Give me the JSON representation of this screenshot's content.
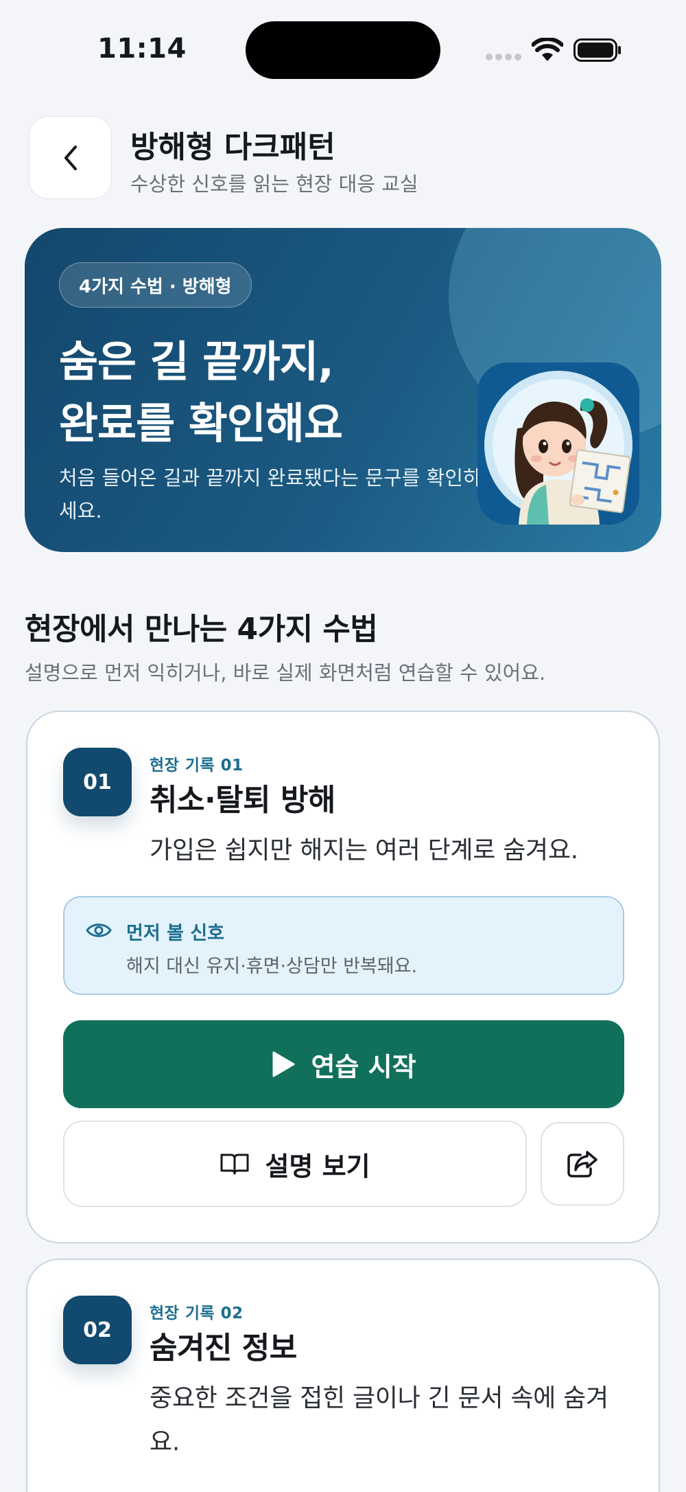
{
  "status_bar": {
    "time": "11:14"
  },
  "header": {
    "title": "방해형 다크패턴",
    "subtitle": "수상한 신호를 읽는 현장 대응 교실"
  },
  "hero": {
    "badge": "4가지 수법 · 방해형",
    "title_line1": "숨은 길 끝까지,",
    "title_line2": "완료를 확인해요",
    "description": "처음 들어온 길과 끝까지 완료됐다는 문구를 확인하세요."
  },
  "section": {
    "title": "현장에서 만나는 4가지 수법",
    "subtitle": "설명으로 먼저 익히거나, 바로 실제 화면처럼 연습할 수 있어요."
  },
  "cards": [
    {
      "number": "01",
      "record_label": "현장 기록 01",
      "title": "취소·탈퇴 방해",
      "description": "가입은 쉽지만 해지는 여러 단계로 숨겨요.",
      "signal_label": "먼저 볼 신호",
      "signal_text": "해지 대신 유지·휴면·상담만 반복돼요.",
      "practice_label": "연습 시작",
      "explain_label": "설명 보기"
    },
    {
      "number": "02",
      "record_label": "현장 기록 02",
      "title": "숨겨진 정보",
      "description": "중요한 조건을 접힌 글이나 긴 문서 속에 숨겨요."
    }
  ],
  "colors": {
    "background": "#f4f5f8",
    "hero_dark": "#14476d",
    "number_badge": "#114a6e",
    "accent_label": "#1c6e8e",
    "practice_button": "#11705c",
    "signal_box_bg": "#e4f2fb"
  },
  "icons": {
    "back": "chevron-left-icon",
    "signal": "eye-icon",
    "practice": "play-icon",
    "explain": "open-book-icon",
    "share": "share-icon"
  }
}
